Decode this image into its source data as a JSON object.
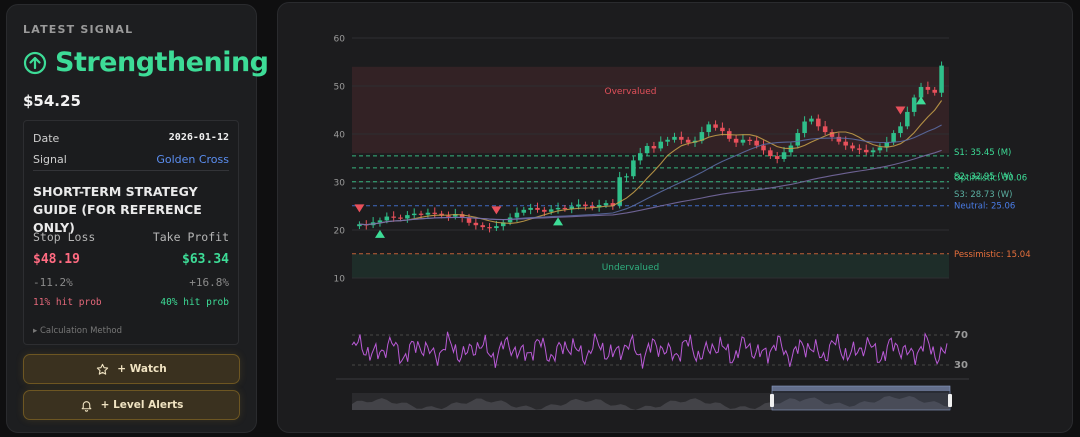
{
  "sidebar": {
    "heading": "LATEST SIGNAL",
    "signal": "Strengthening",
    "price": "$54.25",
    "details": {
      "date_label": "Date",
      "date_value": "2026-01-12",
      "signal_label": "Signal",
      "signal_value": "Golden Cross"
    },
    "guide_title": "SHORT-TERM STRATEGY GUIDE (FOR REFERENCE ONLY)",
    "stop_loss": {
      "label": "Stop Loss",
      "value": "$48.19",
      "pct": "-11.2%",
      "prob": "11% hit prob"
    },
    "take_profit": {
      "label": "Take Profit",
      "value": "$63.34",
      "pct": "+16.8%",
      "prob": "40% hit prob"
    },
    "calc_method": "▸ Calculation Method",
    "buttons": {
      "watch": "+ Watch",
      "alerts": "+ Level Alerts"
    }
  },
  "chart_data": {
    "type": "candlestick",
    "y_axis_ticks": [
      60,
      50,
      40,
      30,
      20,
      10
    ],
    "ylim": [
      10,
      60
    ],
    "zones": [
      {
        "label": "Overvalued",
        "from": 36,
        "to": 54,
        "color": "#e0505a"
      },
      {
        "label": "Undervalued",
        "from": 10,
        "to": 15,
        "color": "#2fae7e"
      }
    ],
    "levels": [
      {
        "label": "S1: 35.45 (M)",
        "value": 35.45,
        "color": "#3ddc97"
      },
      {
        "label": "S2: 32.95 (W)",
        "value": 32.95,
        "color": "#3ddc97"
      },
      {
        "label": "Optimistic: 30.06",
        "value": 30.06,
        "color": "#3ddc97"
      },
      {
        "label": "S3: 28.73 (W)",
        "value": 28.73,
        "color": "#5aaea0"
      },
      {
        "label": "Neutral: 25.06",
        "value": 25.06,
        "color": "#4a7de8"
      },
      {
        "label": "Pessimistic: 15.04",
        "value": 15.04,
        "color": "#e8703c"
      }
    ],
    "closes": [
      21.2,
      21.0,
      21.6,
      22.0,
      22.8,
      22.6,
      22.4,
      23.1,
      23.4,
      23.2,
      23.6,
      23.4,
      23.0,
      22.8,
      23.3,
      22.5,
      21.5,
      21.0,
      20.6,
      20.4,
      20.8,
      21.6,
      22.6,
      23.6,
      24.2,
      24.6,
      24.2,
      23.8,
      24.3,
      24.6,
      24.4,
      24.9,
      25.3,
      25.0,
      24.7,
      25.2,
      25.6,
      25.1,
      31.0,
      31.2,
      34.5,
      36.0,
      37.5,
      37.0,
      38.4,
      38.8,
      39.4,
      38.8,
      38.2,
      38.6,
      40.4,
      42.0,
      41.3,
      40.6,
      39.0,
      38.2,
      38.8,
      38.6,
      37.6,
      36.6,
      35.4,
      34.8,
      36.2,
      37.6,
      40.2,
      42.6,
      43.2,
      41.6,
      40.4,
      39.4,
      38.4,
      37.6,
      37.0,
      36.7,
      36.2,
      36.6,
      37.2,
      38.3,
      40.2,
      41.6,
      44.6,
      47.6,
      49.8,
      49.2,
      48.6,
      54.25
    ],
    "signals": [
      {
        "type": "sell",
        "index": 0
      },
      {
        "type": "buy",
        "index": 3
      },
      {
        "type": "sell",
        "index": 20
      },
      {
        "type": "buy",
        "index": 29
      },
      {
        "type": "sell",
        "index": 79
      },
      {
        "type": "buy",
        "index": 82
      }
    ],
    "rsi_levels": [
      70,
      30
    ]
  }
}
